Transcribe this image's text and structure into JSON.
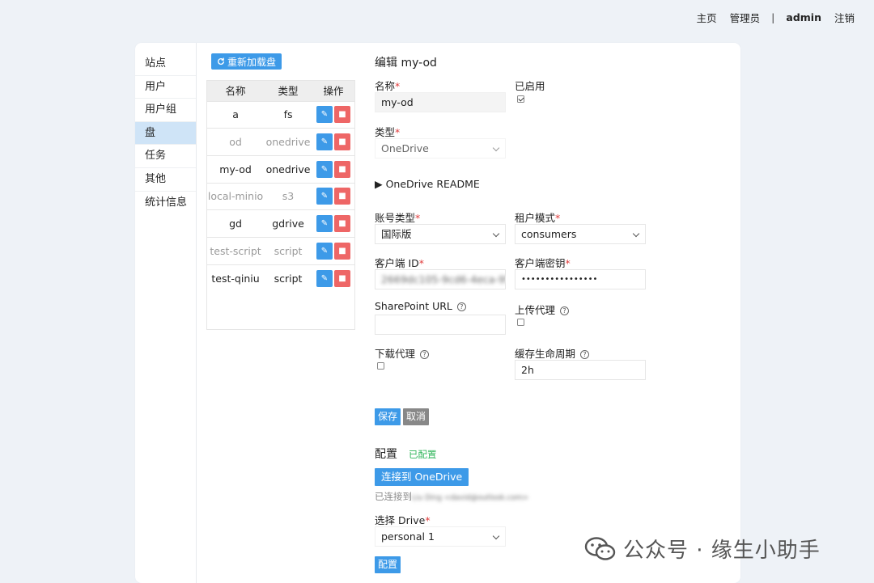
{
  "topnav": {
    "home": "主页",
    "admin_panel": "管理员",
    "separator": "|",
    "user": "admin",
    "logout": "注销"
  },
  "sidebar": {
    "items": [
      {
        "label": "站点"
      },
      {
        "label": "用户"
      },
      {
        "label": "用户组"
      },
      {
        "label": "盘",
        "active": true
      },
      {
        "label": "任务"
      },
      {
        "label": "其他"
      },
      {
        "label": "统计信息"
      }
    ]
  },
  "drives": {
    "reload_label": "重新加载盘",
    "headers": [
      "名称",
      "类型",
      "操作"
    ],
    "rows": [
      {
        "name": "a",
        "type": "fs",
        "enabled": true
      },
      {
        "name": "od",
        "type": "onedrive",
        "enabled": false
      },
      {
        "name": "my-od",
        "type": "onedrive",
        "enabled": true
      },
      {
        "name": "local-minio",
        "type": "s3",
        "enabled": false
      },
      {
        "name": "gd",
        "type": "gdrive",
        "enabled": true
      },
      {
        "name": "test-script",
        "type": "script",
        "enabled": false
      },
      {
        "name": "test-qiniu",
        "type": "script",
        "enabled": true
      }
    ]
  },
  "form": {
    "title": "编辑 my-od",
    "name_label": "名称",
    "name_value": "my-od",
    "enabled_label": "已启用",
    "type_label": "类型",
    "type_value": "OneDrive",
    "readme_label": "▶ OneDrive README",
    "account_type_label": "账号类型",
    "account_type_value": "国际版",
    "tenant_label": "租户模式",
    "tenant_value": "consumers",
    "client_id_label": "客户端 ID",
    "client_id_value": "2669dc105-9cd6-4eca-9563",
    "client_secret_label": "客户端密钥",
    "client_secret_value": "••••••••••••••••",
    "sharepoint_label": "SharePoint URL",
    "upload_proxy_label": "上传代理",
    "download_proxy_label": "下载代理",
    "cache_ttl_label": "缓存生命周期",
    "cache_ttl_value": "2h",
    "save_label": "保存",
    "cancel_label": "取消",
    "required_mark": "*",
    "help_mark": "?"
  },
  "config": {
    "title": "配置",
    "status": "已配置",
    "connect_label": "连接到 OneDrive",
    "connected_prefix": "已连接到",
    "connected_account": "Liu Ding <david@outlook.com>",
    "select_drive_label": "选择 Drive",
    "drive_value": "personal 1",
    "apply_label": "配置"
  },
  "watermark": {
    "text": "公众号 · 缘生小助手"
  },
  "colors": {
    "primary": "#3d9ae8",
    "danger": "#ee6666",
    "active_nav": "#cfe4f7",
    "success": "#2fb55a"
  }
}
